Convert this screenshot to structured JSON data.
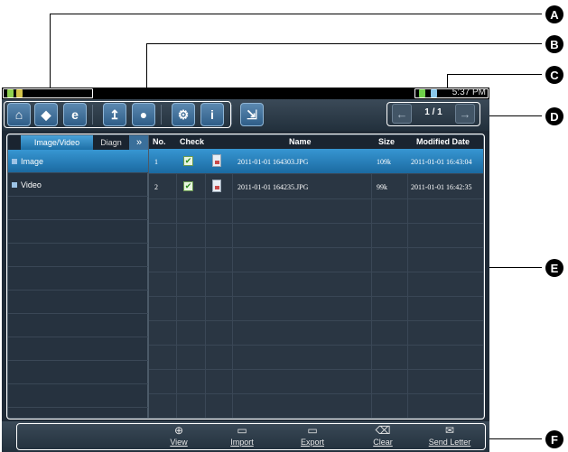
{
  "callouts": {
    "a": "A",
    "b": "B",
    "c": "C",
    "d": "D",
    "e": "E",
    "f": "F"
  },
  "statusbar": {
    "time": "5:37 PM"
  },
  "toolbar": {
    "buttons": [
      {
        "name": "home-icon"
      },
      {
        "name": "diagnose-car-icon"
      },
      {
        "name": "browser-e-icon"
      },
      {
        "name": "update-icon"
      },
      {
        "name": "chat-bubble-icon"
      },
      {
        "name": "settings-gear-icon"
      },
      {
        "name": "info-icon",
        "glyph": "i"
      },
      {
        "name": "exit-icon"
      }
    ],
    "pager": {
      "text": "1 / 1",
      "prev": "←",
      "next": "→"
    }
  },
  "left_pane": {
    "tabs": [
      {
        "label": "Image/Video",
        "active": true
      },
      {
        "label": "Diagn"
      }
    ],
    "more": "»",
    "items": [
      {
        "label": "Image",
        "selected": true
      },
      {
        "label": "Video"
      }
    ]
  },
  "table": {
    "headers": {
      "no": "No.",
      "check": "Check",
      "name": "Name",
      "size": "Size",
      "modified": "Modified Date"
    },
    "rows": [
      {
        "no": "1",
        "checked": "✔",
        "name": "2011-01-01 164303.JPG",
        "size": "109k",
        "modified": "2011-01-01 16:43:04",
        "selected": true
      },
      {
        "no": "2",
        "checked": "✔",
        "name": "2011-01-01 164235.JPG",
        "size": "99k",
        "modified": "2011-01-01 16:42:35"
      }
    ]
  },
  "bottom_bar": {
    "buttons": [
      {
        "label": "View",
        "icon": "⊕"
      },
      {
        "label": "Import",
        "icon": "▭"
      },
      {
        "label": "Export",
        "icon": "▭"
      },
      {
        "label": "Clear",
        "icon": "⌫"
      },
      {
        "label": "Send Letter",
        "icon": "✉"
      }
    ]
  },
  "colors": {
    "accent": "#2a85c4",
    "background": "#1f2a36"
  }
}
